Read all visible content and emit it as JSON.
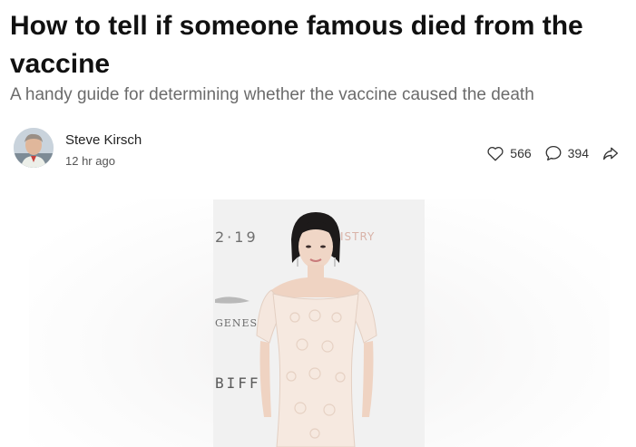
{
  "article": {
    "title": "How to tell if someone famous died from the vaccine",
    "subtitle": "A handy guide for determining whether the vaccine caused the death"
  },
  "byline": {
    "author": "Steve Kirsch",
    "time": "12 hr ago",
    "avatar_icon": "author-avatar"
  },
  "actions": {
    "likes": "566",
    "comments": "394",
    "like_icon": "heart-icon",
    "comment_icon": "comment-icon",
    "share_icon": "share-icon"
  },
  "hero_image": {
    "backdrop_text_year": "2·19",
    "backdrop_text_brand": "ISTRY",
    "backdrop_text_sponsor": "GENES",
    "backdrop_text_event": "BIFF"
  }
}
